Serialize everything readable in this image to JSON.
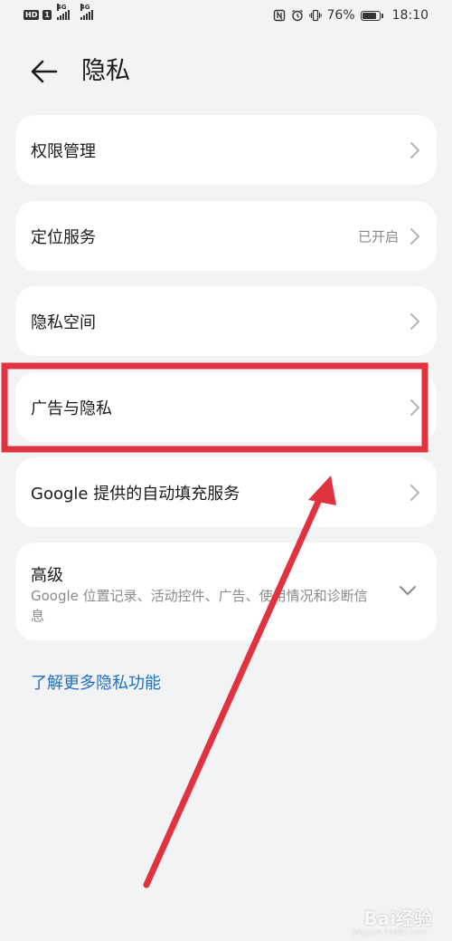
{
  "status_bar": {
    "left_badge": "HD",
    "sim1": "1",
    "sig1_tag": "4G",
    "sig2_tag": "4G",
    "battery_percent": "76%",
    "time": "18:10"
  },
  "header": {
    "title": "隐私"
  },
  "settings": {
    "items": [
      {
        "label": "权限管理",
        "value": ""
      },
      {
        "label": "定位服务",
        "value": "已开启"
      },
      {
        "label": "隐私空间",
        "value": ""
      },
      {
        "label": "广告与隐私",
        "value": ""
      },
      {
        "label": "Google 提供的自动填充服务",
        "value": ""
      }
    ],
    "advanced": {
      "title": "高级",
      "description": "Google 位置记录、活动控件、广告、使用情况和诊断信息"
    }
  },
  "learn_more": "了解更多隐私功能",
  "annotation": {
    "color": "#e0323f",
    "watermark": "Bai经验",
    "watermark_sub": "jingyan.baidu.com"
  },
  "colors": {
    "background": "#f1f3f5",
    "card": "#ffffff",
    "link": "#1f6fc4"
  }
}
